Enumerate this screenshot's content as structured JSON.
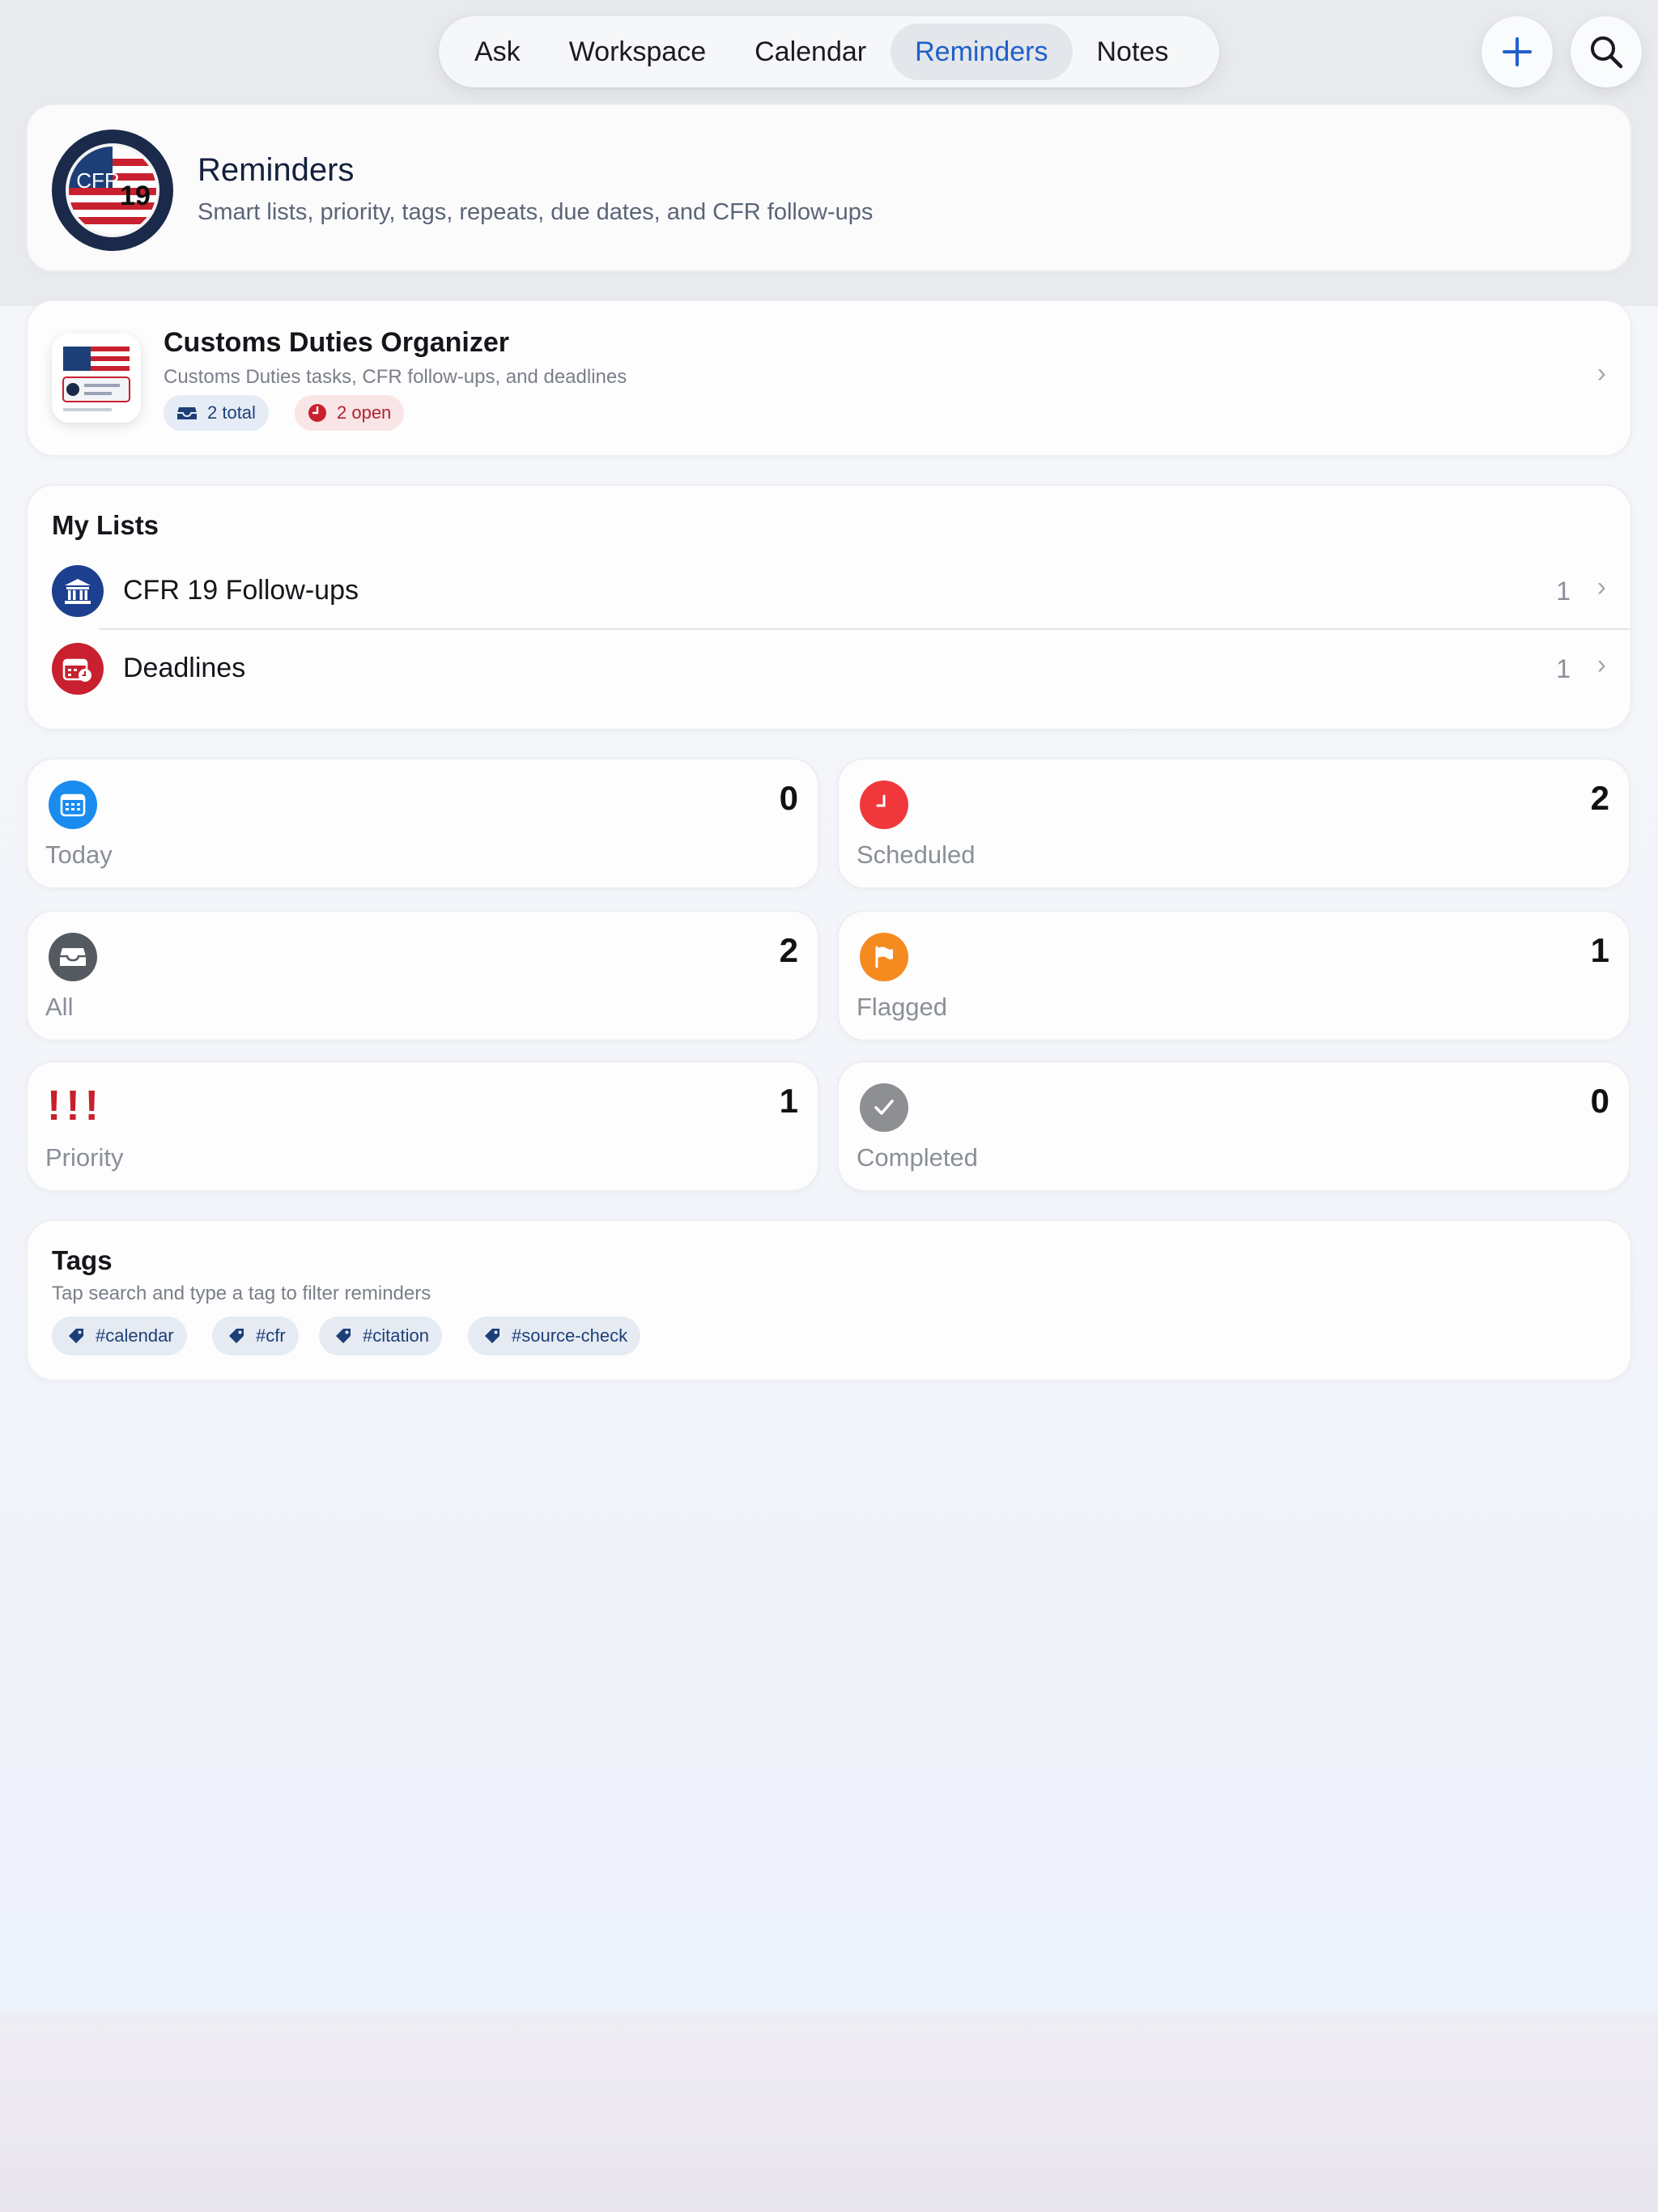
{
  "nav": {
    "tabs": [
      {
        "label": "Ask"
      },
      {
        "label": "Workspace"
      },
      {
        "label": "Calendar"
      },
      {
        "label": "Reminders",
        "active": true
      },
      {
        "label": "Notes"
      }
    ]
  },
  "header": {
    "title": "Reminders",
    "subtitle": "Smart lists, priority, tags, repeats, due dates, and CFR follow-ups",
    "logo_text": "CFR",
    "logo_number": "19"
  },
  "organizer": {
    "title": "Customs Duties Organizer",
    "subtitle": "Customs Duties tasks, CFR follow-ups, and deadlines",
    "total_label": "2 total",
    "open_label": "2 open"
  },
  "my_lists": {
    "title": "My Lists",
    "items": [
      {
        "label": "CFR 19 Follow-ups",
        "count": "1",
        "color": "#1d3f8f",
        "icon": "bank-icon"
      },
      {
        "label": "Deadlines",
        "count": "1",
        "color": "#c8202e",
        "icon": "calendar-clock-icon"
      }
    ]
  },
  "smart_lists": [
    {
      "label": "Today",
      "count": "0",
      "color": "#1a8cf0",
      "icon": "calendar-icon"
    },
    {
      "label": "Scheduled",
      "count": "2",
      "color": "#f0383c",
      "icon": "clock-icon"
    },
    {
      "label": "All",
      "count": "2",
      "color": "#555a60",
      "icon": "tray-icon"
    },
    {
      "label": "Flagged",
      "count": "1",
      "color": "#f58a1f",
      "icon": "flag-icon"
    },
    {
      "label": "Priority",
      "count": "1",
      "color": "#c8202e",
      "icon": "exclamation-icon",
      "glyph": "!!!"
    },
    {
      "label": "Completed",
      "count": "0",
      "color": "#8e8f93",
      "icon": "checkmark-icon"
    }
  ],
  "tags": {
    "title": "Tags",
    "subtitle": "Tap search and type a tag to filter reminders",
    "items": [
      "#calendar",
      "#cfr",
      "#citation",
      "#source-check"
    ]
  },
  "colors": {
    "accent": "#1f5fc9",
    "navy": "#1d3f78",
    "red": "#c8202e"
  }
}
